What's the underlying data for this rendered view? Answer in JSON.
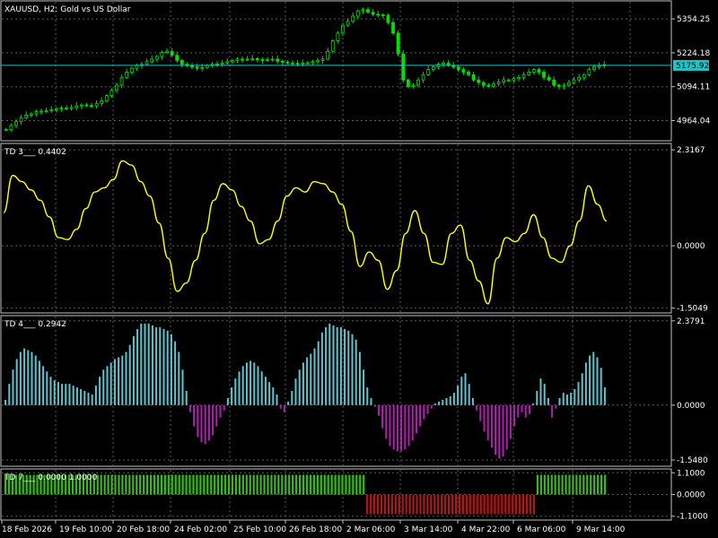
{
  "window": {
    "symbol_title": "XAUUSD, H2:  Gold vs US Dollar",
    "current_price_label": "5175.92"
  },
  "colors": {
    "background": "#000000",
    "grid": "#5a5a5a",
    "candle": "#00e000",
    "price_line": "#20c4c4",
    "td3_line": "#ffff00",
    "td4_positive": "#5fc4d0",
    "td4_negative": "#b020b0",
    "td7_positive": "#3ab820",
    "td7_negative": "#b01818",
    "text": "#ffffff"
  },
  "chart_data": [
    {
      "name": "price",
      "type": "candlestick",
      "title": "XAUUSD, H2:  Gold vs US Dollar",
      "ylim": [
        4890,
        5420
      ],
      "y_ticks": [
        "5354.25",
        "5224.18",
        "5094.11",
        "4964.04"
      ],
      "y_tick_values": [
        5354.25,
        5224.18,
        5094.11,
        4964.04
      ],
      "current_price": 5175.92,
      "close_approx": [
        4930,
        4945,
        4960,
        4975,
        4985,
        4990,
        4998,
        5000,
        5002,
        5006,
        5010,
        5012,
        5010,
        5014,
        5020,
        5024,
        5022,
        5020,
        5030,
        5040,
        5060,
        5080,
        5100,
        5130,
        5150,
        5165,
        5175,
        5180,
        5190,
        5200,
        5210,
        5225,
        5230,
        5215,
        5195,
        5180,
        5175,
        5170,
        5165,
        5168,
        5175,
        5180,
        5182,
        5185,
        5190,
        5195,
        5200,
        5198,
        5200,
        5202,
        5198,
        5195,
        5198,
        5200,
        5192,
        5188,
        5185,
        5182,
        5184,
        5185,
        5186,
        5190,
        5195,
        5200,
        5230,
        5270,
        5300,
        5330,
        5345,
        5365,
        5385,
        5390,
        5380,
        5372,
        5370,
        5368,
        5340,
        5300,
        5220,
        5120,
        5095,
        5100,
        5120,
        5140,
        5160,
        5170,
        5180,
        5185,
        5176,
        5170,
        5160,
        5150,
        5140,
        5120,
        5110,
        5100,
        5096,
        5105,
        5112,
        5120,
        5118,
        5125,
        5130,
        5140,
        5150,
        5160,
        5150,
        5130,
        5120,
        5100,
        5095,
        5100,
        5110,
        5120,
        5130,
        5140,
        5160,
        5170,
        5175,
        5178
      ]
    },
    {
      "name": "TD 3",
      "type": "line",
      "title": "TD 3___  0.4402",
      "ylim": [
        -1.6,
        2.45
      ],
      "y_ticks": [
        "2.3167",
        "0.0000",
        "-1.5049"
      ],
      "y_tick_values": [
        2.3167,
        0,
        -1.5049
      ],
      "values": [
        0.8,
        1.7,
        1.55,
        1.35,
        1.1,
        0.7,
        0.2,
        0.15,
        0.4,
        0.9,
        1.3,
        1.4,
        1.6,
        2.05,
        1.95,
        1.55,
        1.2,
        0.55,
        -0.3,
        -1.1,
        -0.9,
        -0.35,
        0.3,
        1.1,
        1.5,
        1.35,
        0.95,
        0.6,
        0.05,
        0.15,
        0.6,
        1.2,
        1.4,
        1.3,
        1.55,
        1.5,
        1.3,
        1.0,
        0.35,
        -0.5,
        -0.15,
        -0.35,
        -1.05,
        -0.6,
        0.3,
        0.85,
        0.3,
        -0.4,
        -0.45,
        0.3,
        0.5,
        -0.35,
        -0.85,
        -1.4,
        -0.3,
        0.2,
        0.1,
        0.3,
        0.75,
        0.2,
        -0.3,
        -0.4,
        0.0,
        0.6,
        1.45,
        1.0,
        0.6
      ]
    },
    {
      "name": "TD 4",
      "type": "histogram",
      "title": "TD 4___  0.2942",
      "ylim": [
        -1.7,
        2.5
      ],
      "y_ticks": [
        "2.3791",
        "0.0000",
        "-1.5480"
      ],
      "y_tick_values": [
        2.3791,
        0,
        -1.548
      ],
      "values": [
        0.15,
        0.6,
        1.0,
        1.3,
        1.5,
        1.6,
        1.55,
        1.5,
        1.4,
        1.25,
        1.1,
        0.95,
        0.8,
        0.7,
        0.65,
        0.6,
        0.6,
        0.6,
        0.55,
        0.5,
        0.45,
        0.4,
        0.35,
        0.3,
        0.55,
        0.8,
        1.0,
        1.1,
        1.2,
        1.3,
        1.35,
        1.4,
        1.5,
        1.7,
        1.95,
        2.15,
        2.3,
        2.3,
        2.3,
        2.25,
        2.2,
        2.2,
        2.15,
        2.1,
        2.0,
        1.8,
        1.5,
        1.0,
        0.4,
        -0.2,
        -0.6,
        -0.9,
        -1.05,
        -1.1,
        -1.0,
        -0.85,
        -0.6,
        -0.35,
        -0.15,
        0.2,
        0.5,
        0.75,
        0.95,
        1.1,
        1.2,
        1.25,
        1.2,
        1.1,
        0.95,
        0.8,
        0.65,
        0.5,
        0.3,
        -0.1,
        -0.2,
        0.1,
        0.4,
        0.75,
        1.0,
        1.2,
        1.35,
        1.45,
        1.6,
        1.8,
        2.05,
        2.2,
        2.3,
        2.25,
        2.2,
        2.2,
        2.15,
        2.1,
        2.0,
        1.85,
        1.5,
        1.0,
        0.5,
        0.2,
        -0.05,
        -0.3,
        -0.65,
        -0.95,
        -1.15,
        -1.25,
        -1.3,
        -1.3,
        -1.25,
        -1.15,
        -1.0,
        -0.8,
        -0.6,
        -0.4,
        -0.25,
        -0.1,
        0.05,
        0.1,
        0.15,
        0.2,
        0.25,
        0.35,
        0.55,
        0.8,
        0.9,
        0.6,
        0.2,
        -0.15,
        -0.45,
        -0.75,
        -1.0,
        -1.2,
        -1.4,
        -1.5,
        -1.45,
        -1.25,
        -0.95,
        -0.6,
        -0.35,
        -0.2,
        -0.35,
        -0.25,
        0.05,
        0.4,
        0.75,
        0.6,
        0.2,
        -0.35,
        -0.1,
        0.2,
        0.35,
        0.3,
        0.35,
        0.45,
        0.65,
        0.9,
        1.2,
        1.4,
        1.5,
        1.35,
        1.05,
        0.5
      ]
    },
    {
      "name": "TD 7",
      "type": "histogram",
      "title": "TD 7___  0.0000  1.0000",
      "ylim": [
        -1.25,
        1.25
      ],
      "y_ticks": [
        "1.1000",
        "0.0000",
        "-1.1000"
      ],
      "y_tick_values": [
        1.1,
        0,
        -1.1
      ],
      "segments": [
        {
          "count": 102,
          "value": 1
        },
        {
          "count": 48,
          "value": -1
        },
        {
          "count": 20,
          "value": 1
        }
      ]
    }
  ],
  "x_axis": {
    "labels": [
      "18 Feb 2026",
      "19 Feb 10:00",
      "20 Feb 18:00",
      "24 Feb 02:00",
      "25 Feb 10:00",
      "26 Feb 18:00",
      "2 Mar 06:00",
      "3 Mar 14:00",
      "4 Mar 22:00",
      "6 Mar 06:00",
      "9 Mar 14:00"
    ]
  }
}
